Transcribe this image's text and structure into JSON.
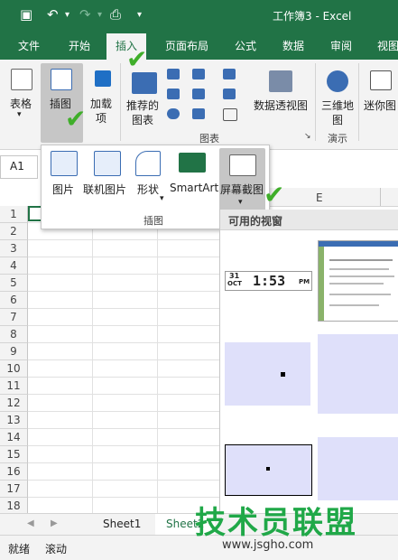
{
  "titlebar": {
    "title": "工作簿3 - Excel",
    "save_icon": "save-icon",
    "undo_icon": "undo-icon",
    "redo_icon": "redo-icon",
    "preview_icon": "print-preview-icon",
    "qat_more": "▾"
  },
  "tabs": [
    "文件",
    "开始",
    "插入",
    "页面布局",
    "公式",
    "数据",
    "审阅",
    "视图"
  ],
  "active_tab": "插入",
  "ribbon": {
    "table_label": "表格",
    "illustrations_label": "插图",
    "addins_label_1": "加载",
    "addins_label_2": "项",
    "recommended_charts_1": "推荐的",
    "recommended_charts_2": "图表",
    "pivotchart_label": "数据透视图",
    "map3d_label_1": "三维地",
    "map3d_label_2": "图",
    "sparkline_label": "迷你图",
    "group_charts": "图表",
    "group_demo": "演示"
  },
  "namebox": {
    "value": "A1"
  },
  "columns": [
    "E"
  ],
  "rows": [
    "1",
    "2",
    "3",
    "4",
    "5",
    "6",
    "7",
    "8",
    "9",
    "10",
    "11",
    "12",
    "13",
    "14",
    "15",
    "16",
    "17",
    "18"
  ],
  "illustrations_menu": {
    "items": [
      {
        "label": "图片",
        "icon": "picture-icon"
      },
      {
        "label": "联机图片",
        "icon": "online-picture-icon"
      },
      {
        "label": "形状",
        "icon": "shapes-icon"
      },
      {
        "label": "SmartArt",
        "icon": "smartart-icon"
      },
      {
        "label": "屏幕截图",
        "icon": "screenshot-icon"
      }
    ],
    "group_label": "插图"
  },
  "screenshot_panel": {
    "header": "可用的视窗",
    "clock_date_top": "31",
    "clock_date_bottom": "OCT",
    "clock_time": "1:53",
    "clock_ampm": "PM"
  },
  "sheets": [
    "Sheet1",
    "Sheet2"
  ],
  "status": {
    "ready": "就绪",
    "scroll": "滚动"
  },
  "watermark": {
    "text": "技术员联盟",
    "url": "www.jsgho.com"
  },
  "colors": {
    "excel_green": "#217346",
    "check_green": "#3fae2a",
    "pane_bg": "#dfe0fa"
  }
}
